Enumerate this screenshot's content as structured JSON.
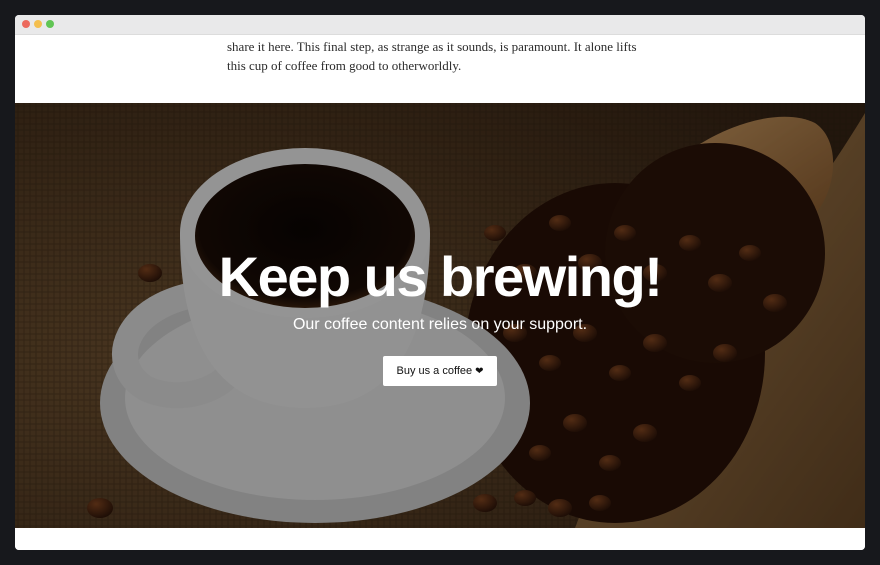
{
  "article": {
    "line1": "share it here. This final step, as strange as it sounds, is paramount. It alone lifts",
    "line2": "this cup of coffee from good to otherworldly."
  },
  "hero": {
    "title": "Keep us brewing!",
    "subtitle": "Our coffee content relies on your support.",
    "cta_label": "Buy us a coffee",
    "cta_icon": "heart-icon",
    "cta_heart_glyph": "❤"
  },
  "colors": {
    "page_bg": "#17181c",
    "window_bg": "#ffffff",
    "titlebar": "#e9e9ea",
    "traffic_red": "#ec6a5e",
    "traffic_yellow": "#f4bf4f",
    "traffic_green": "#61c554"
  }
}
